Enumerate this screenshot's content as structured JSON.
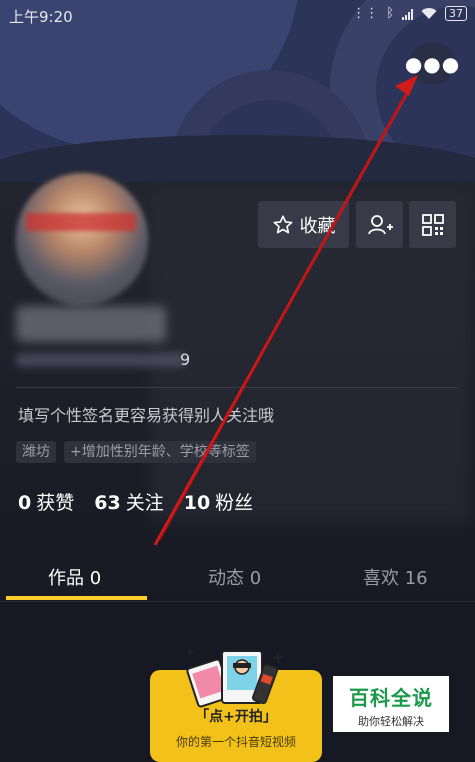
{
  "status_bar": {
    "time": "上午9:20",
    "battery": "37"
  },
  "profile": {
    "douyin_id_tail": "9",
    "bio_placeholder": "填写个性签名更容易获得别人关注哦",
    "tags": {
      "city": "潍坊",
      "add": "+增加性别年龄、学校等标签"
    },
    "actions": {
      "favorites_label": "收藏"
    },
    "stats": {
      "likes_count": "0",
      "likes_label": "获赞",
      "following_count": "63",
      "following_label": "关注",
      "followers_count": "10",
      "followers_label": "粉丝"
    }
  },
  "tabs": [
    {
      "label": "作品 0"
    },
    {
      "label": "动态 0"
    },
    {
      "label": "喜欢 16"
    }
  ],
  "create_card": {
    "title": "「点+开拍」",
    "subtitle": "你的第一个抖音短视频"
  },
  "watermark": {
    "main": "百科全说",
    "sub": "助你轻松解决"
  },
  "colors": {
    "accent": "#facd2b",
    "background": "#161823",
    "annotation_arrow": "#d11a1a"
  }
}
